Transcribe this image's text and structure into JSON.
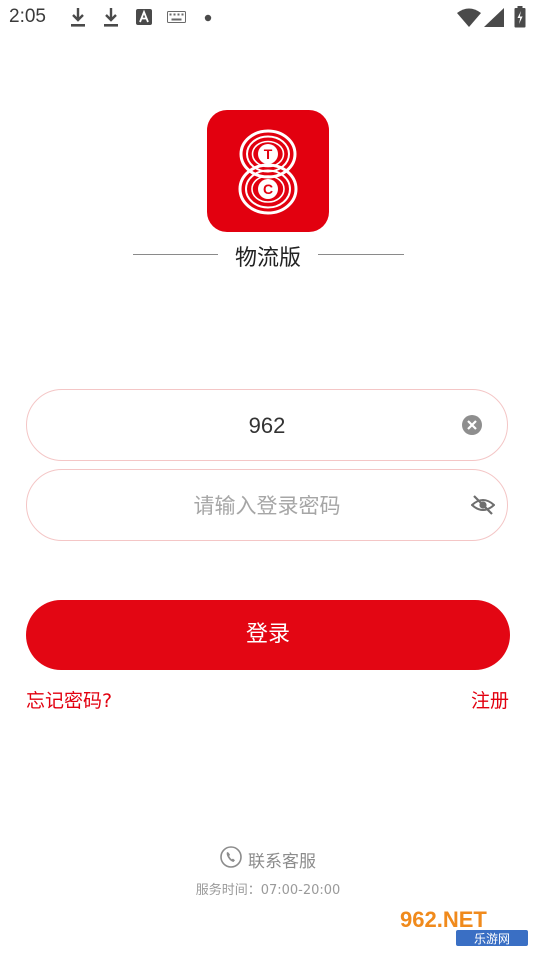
{
  "status_bar": {
    "time": "2:05",
    "icons": [
      "download-icon",
      "download-icon",
      "text-a-icon",
      "keyboard-icon",
      "dot-icon",
      "wifi-icon",
      "signal-icon",
      "battery-charging-icon"
    ]
  },
  "brand": {
    "logo_letters": [
      "T",
      "C"
    ],
    "subtitle": "物流版",
    "color": "#e2000f"
  },
  "login_form": {
    "phone_value": "962",
    "phone_clear_icon": "clear-circle-icon",
    "password_placeholder": "请输入登录密码",
    "password_visibility_icon": "eye-off-icon",
    "login_label": "登录",
    "forgot_password": "忘记密码?",
    "register": "注册"
  },
  "service": {
    "icon": "phone-icon",
    "label": "联系客服",
    "hours": "服务时间：07:00-20:00"
  },
  "watermark": {
    "top_text": "962.NET",
    "bottom_text": "乐游网"
  }
}
